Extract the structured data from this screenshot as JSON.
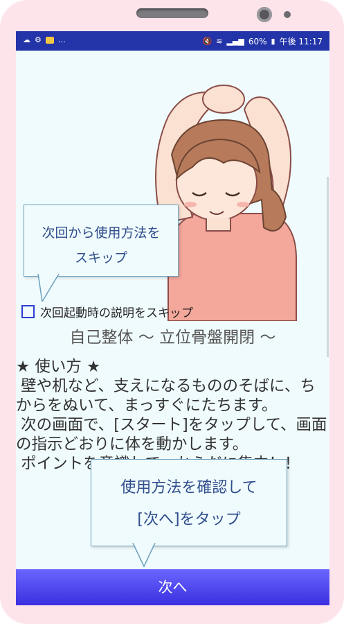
{
  "status_bar": {
    "left_icons": [
      "cloud-icon",
      "settings-icon",
      "notification-icon",
      "more-icon"
    ],
    "overflow_text": "…",
    "battery": "60%",
    "time": "午後 11:17"
  },
  "bubble_top": {
    "line1": "次回から使用方法を",
    "line2": "スキップ"
  },
  "checkbox": {
    "label": "次回起動時の説明をスキップ",
    "checked": false
  },
  "subtitle": "自己整体 〜 立位骨盤開閉 〜",
  "howto": {
    "heading": "★ 使い方 ★",
    "p1": " 壁や机など、支えになるもののそばに、ちからをぬいて、まっすぐにたちます。",
    "p2": " 次の画面で、[スタート]をタップして、画面の指示どおりに体を動かします。",
    "p3": " ポイントを意識して、からだに集中！！"
  },
  "bubble_bottom": {
    "line1": "使用方法を確認して",
    "line2": "[次へ]をタップ"
  },
  "next_button": "次へ",
  "colors": {
    "status_bar": "#2234a8",
    "button": "#4b45f0",
    "bubble_text": "#2f4d8c",
    "phone_frame": "#fde3ea"
  }
}
